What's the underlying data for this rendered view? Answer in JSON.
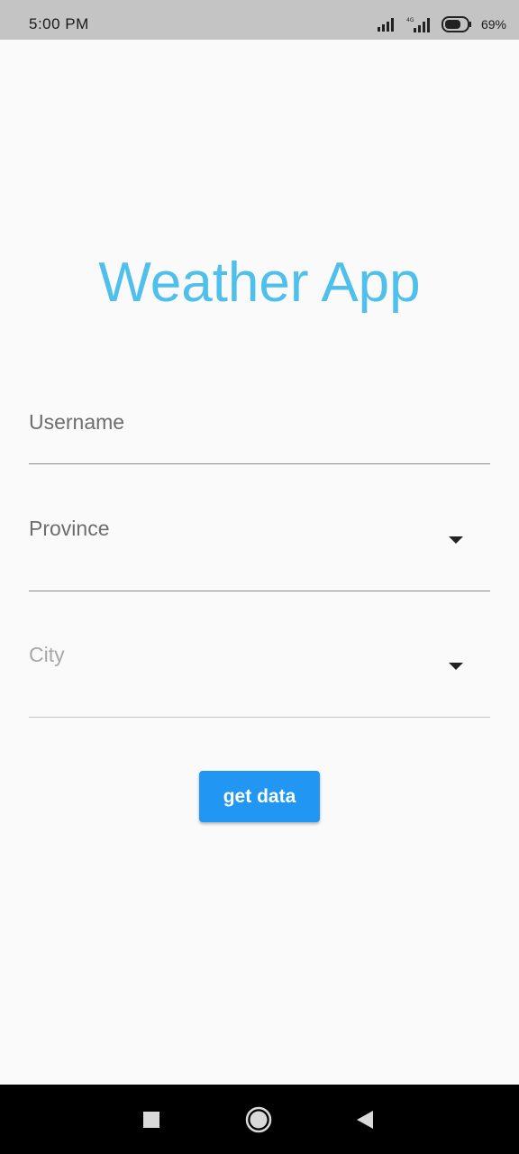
{
  "status_bar": {
    "time": "5:00 PM",
    "battery": "69%",
    "icons": [
      "cellular-signal-icon",
      "cellular-4g-signal-icon",
      "battery-icon"
    ]
  },
  "app": {
    "title": "Weather App",
    "title_color": "#4fc0ec",
    "background": "#fafafa"
  },
  "form": {
    "username": {
      "label": "Username",
      "value": ""
    },
    "province": {
      "label": "Province",
      "value": "",
      "icon": "dropdown-arrow-icon"
    },
    "city": {
      "label": "City",
      "value": "",
      "disabled": true,
      "icon": "dropdown-arrow-icon"
    },
    "submit": {
      "label": "get data",
      "color": "#2196f3"
    }
  },
  "nav_bar": {
    "buttons": [
      "recent-apps-icon",
      "home-icon",
      "back-icon"
    ]
  }
}
